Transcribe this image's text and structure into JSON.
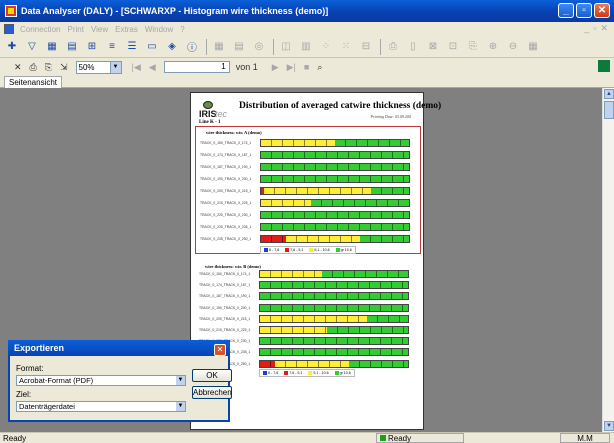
{
  "window": {
    "title": "Data Analyser (DALY) - [SCHWARXP - Histogram wire thickness (demo)]"
  },
  "menu": [
    "Connection",
    "Print",
    "View",
    "Extras",
    "Window",
    "?"
  ],
  "toolbar2": {
    "zoom": "50%",
    "page_current": "1",
    "page_of": "von 1"
  },
  "tabs": [
    {
      "label": "Seitenansicht"
    }
  ],
  "report": {
    "logo_text": "IRIS",
    "logo_suffix": "tec",
    "title": "Distribution of averaged catwire thickness (demo)",
    "printing_date": "Printing Date: 03.09.200",
    "line_id": "Line K - 1",
    "colors": {
      "blue": "#1d3fc8",
      "red": "#e31a1a",
      "yellow": "#ffee33",
      "green": "#33cc33"
    },
    "legend": [
      "6 - 7,6",
      "7,6 - 9,1",
      "9,1 - 10,6",
      "gr 10,6"
    ],
    "sections": [
      {
        "title": "wire thickness: wir. A (demo)",
        "rows": [
          {
            "label": "TRACK_0_150_TRACK_0_174_1",
            "segments": [
              0,
              0,
              50,
              50
            ]
          },
          {
            "label": "TRACK_0_174_TRACK_0_187_1",
            "segments": [
              0,
              0,
              0,
              100
            ]
          },
          {
            "label": "TRACK_0_187_TRACK_0_190_1",
            "segments": [
              0,
              0,
              0,
              100
            ]
          },
          {
            "label": "TRACK_0_190_TRACK_0_200_1",
            "segments": [
              0,
              0,
              0,
              100
            ]
          },
          {
            "label": "TRACK_0_200_TRACK_0_215_1",
            "segments": [
              0,
              2,
              72,
              26
            ]
          },
          {
            "label": "TRACK_0_215_TRACK_0_225_1",
            "segments": [
              0,
              0,
              34,
              66
            ]
          },
          {
            "label": "TRACK_0_225_TRACK_0_230_1",
            "segments": [
              0,
              0,
              0,
              100
            ]
          },
          {
            "label": "TRACK_0_230_TRACK_0_235_1",
            "segments": [
              0,
              0,
              0,
              100
            ]
          },
          {
            "label": "TRACK_0_235_TRACK_0_250_1",
            "segments": [
              0,
              17,
              50,
              33
            ]
          }
        ]
      },
      {
        "title": "wire thickness: wir. B (demo)",
        "rows": [
          {
            "label": "TRACK_0_150_TRACK_0_174_1",
            "segments": [
              0,
              0,
              42,
              58
            ]
          },
          {
            "label": "TRACK_0_174_TRACK_0_187_1",
            "segments": [
              0,
              0,
              0,
              100
            ]
          },
          {
            "label": "TRACK_0_187_TRACK_0_190_1",
            "segments": [
              0,
              0,
              0,
              100
            ]
          },
          {
            "label": "TRACK_0_190_TRACK_0_200_1",
            "segments": [
              0,
              0,
              0,
              100
            ]
          },
          {
            "label": "TRACK_0_200_TRACK_0_215_1",
            "segments": [
              0,
              0,
              72,
              28
            ]
          },
          {
            "label": "TRACK_0_215_TRACK_0_225_1",
            "segments": [
              0,
              0,
              45,
              55
            ]
          },
          {
            "label": "TRACK_0_225_TRACK_0_230_1",
            "segments": [
              0,
              0,
              0,
              100
            ]
          },
          {
            "label": "TRACK_0_230_TRACK_0_235_1",
            "segments": [
              0,
              0,
              0,
              100
            ]
          },
          {
            "label": "TRACK_0_235_TRACK_0_250_1",
            "segments": [
              0,
              10,
              50,
              40
            ]
          }
        ]
      }
    ]
  },
  "dialog": {
    "title": "Exportieren",
    "format_label": "Format:",
    "format_value": "Acrobat-Format (PDF)",
    "target_label": "Ziel:",
    "target_value": "Datenträgerdatei",
    "ok_label": "OK",
    "cancel_label": "Abbrechen"
  },
  "status": {
    "left": "Ready",
    "middle": "Ready",
    "right": "M.M"
  }
}
